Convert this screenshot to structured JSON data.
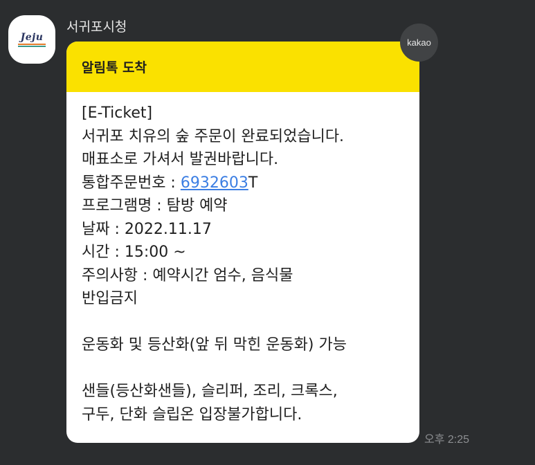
{
  "sender": {
    "name": "서귀포시청",
    "avatar_logo_text": "Jeju",
    "avatar_colors": [
      "#e27b2a",
      "#3a9a8c"
    ]
  },
  "badge": {
    "label": "kakao"
  },
  "message": {
    "header_title": "알림톡 도착",
    "header_color": "#fae100",
    "lines": {
      "l1": "[E-Ticket]",
      "l2": "서귀포 치유의 숲 주문이 완료되었습니다.",
      "l3": "매표소로 가셔서 발권바랍니다.",
      "order_prefix": "통합주문번호 : ",
      "order_link": "6932603",
      "order_suffix": "T",
      "l5": "프로그램명 : 탐방 예약",
      "l6": "날짜 : 2022.11.17",
      "l7": "시간 : 15:00 ~",
      "l8": "주의사항 : 예약시간 엄수, 음식물",
      "l9": "반입금지",
      "l10": "운동화 및 등산화(앞 뒤 막힌 운동화) 가능",
      "l11": "샌들(등산화샌들), 슬리퍼, 조리, 크록스,",
      "l12": "구두, 단화 슬립온 입장불가합니다."
    },
    "link_color": "#3b7ee3"
  },
  "timestamp": "오후 2:25"
}
